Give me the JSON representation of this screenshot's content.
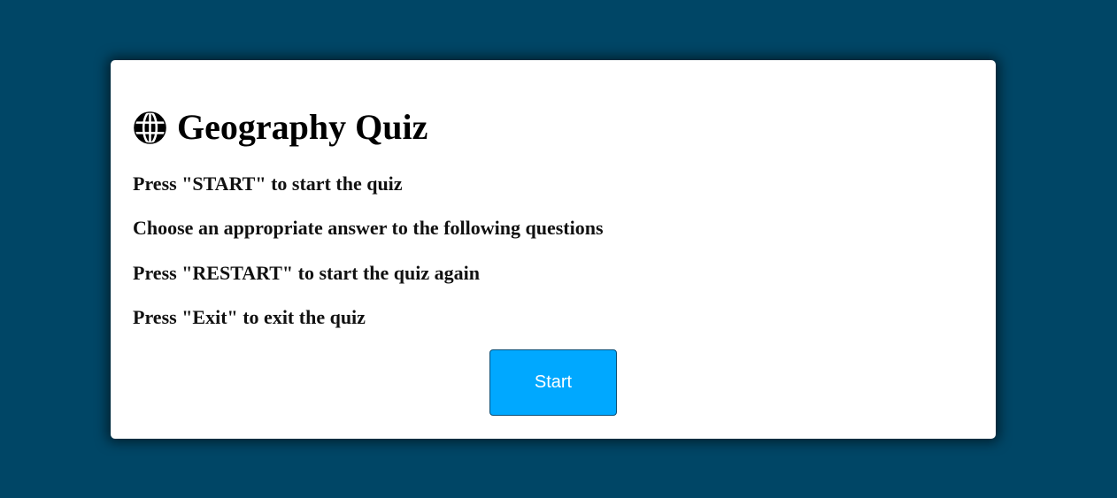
{
  "quiz": {
    "icon": "globe-icon",
    "title": "Geography Quiz",
    "instructions": [
      "Press \"START\" to start the quiz",
      "Choose an appropriate answer to the following questions",
      "Press \"RESTART\" to start the quiz again",
      "Press \"Exit\" to exit the quiz"
    ],
    "start_label": "Start"
  },
  "colors": {
    "background": "#004666",
    "card": "#ffffff",
    "button": "#00a8ff",
    "button_text": "#ffffff"
  }
}
